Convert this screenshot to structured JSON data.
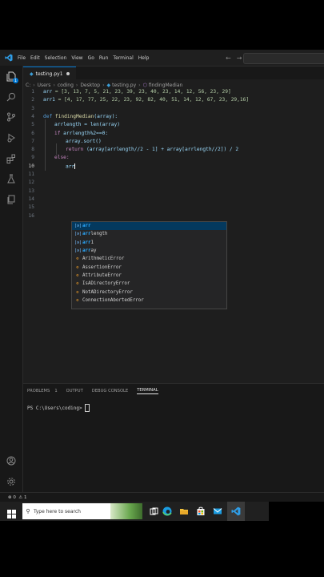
{
  "titlebar": {
    "menu": [
      "File",
      "Edit",
      "Selection",
      "View",
      "Go",
      "Run",
      "Terminal",
      "Help"
    ],
    "back_icon": "arrow-left-icon",
    "forward_icon": "arrow-right-icon"
  },
  "activity": {
    "explorer_badge": "1",
    "icons": [
      "files-icon",
      "search-icon",
      "source-control-icon",
      "run-debug-icon",
      "extensions-icon",
      "testing-icon",
      "copy-icon"
    ],
    "bottom_icons": [
      "account-icon",
      "settings-gear-icon"
    ]
  },
  "tab": {
    "filename": "testing.py",
    "count": "1"
  },
  "breadcrumb": [
    "C:",
    "Users",
    "coding",
    "Desktop",
    "testing.py",
    "findingMedian"
  ],
  "code": {
    "line_numbers": [
      "1",
      "2",
      "3",
      "4",
      "5",
      "6",
      "7",
      "8",
      "9",
      "10",
      "11",
      "12",
      "13",
      "14",
      "15",
      "16"
    ],
    "l1_var": "arr",
    "l1_rest": " = [3, 13, 7, 5, 21, 23, 39, 23, 40, 23, 14, 12, 56, 23, 29]",
    "l2_var": "arr1",
    "l2_rest": " = [4, 17, 77, 25, 22, 23, 92, 82, 40, 51, 14, 12, 67, 23, 29,16]",
    "l4_def": "def",
    "l4_fn": "findingMedian",
    "l4_rest": "(array):",
    "l5": "arrlength = len(array)",
    "l6_if": "if",
    "l6_rest": " arrlength%2==0:",
    "l7": "array.sort()",
    "l8_return": "return",
    "l8_rest": " (array[arrlength//2 - 1] + array[arrlength//2]) / 2",
    "l9": "else:",
    "l10": "arr"
  },
  "suggestions": [
    {
      "kind": "variable",
      "text": "arr"
    },
    {
      "kind": "variable",
      "text": "arrlength"
    },
    {
      "kind": "variable",
      "text": "arr1"
    },
    {
      "kind": "variable",
      "text": "array"
    },
    {
      "kind": "class",
      "text": "ArithmeticError"
    },
    {
      "kind": "class",
      "text": "AssertionError"
    },
    {
      "kind": "class",
      "text": "AttributeError"
    },
    {
      "kind": "class",
      "text": "IsADirectoryError"
    },
    {
      "kind": "class",
      "text": "NotADirectoryError"
    },
    {
      "kind": "class",
      "text": "ConnectionAbortedError"
    }
  ],
  "suggestion_match": "arr",
  "panel": {
    "tabs": [
      "PROBLEMS",
      "OUTPUT",
      "DEBUG CONSOLE",
      "TERMINAL"
    ],
    "problems_count": "1",
    "active_tab": "TERMINAL",
    "prompt": "PS C:\\Users\\coding>"
  },
  "statusbar": {
    "errors": "0",
    "warnings": "1"
  },
  "taskbar": {
    "search_placeholder": "Type here to search",
    "apps": [
      "task-view-icon",
      "edge-icon",
      "file-explorer-icon",
      "store-icon",
      "mail-icon",
      "vscode-icon"
    ]
  },
  "colors": {
    "accent": "#0078d4",
    "editor_bg": "#1e1e1e",
    "keyword": "#569cd6",
    "function": "#dcdcaa",
    "number": "#b5cea8"
  }
}
